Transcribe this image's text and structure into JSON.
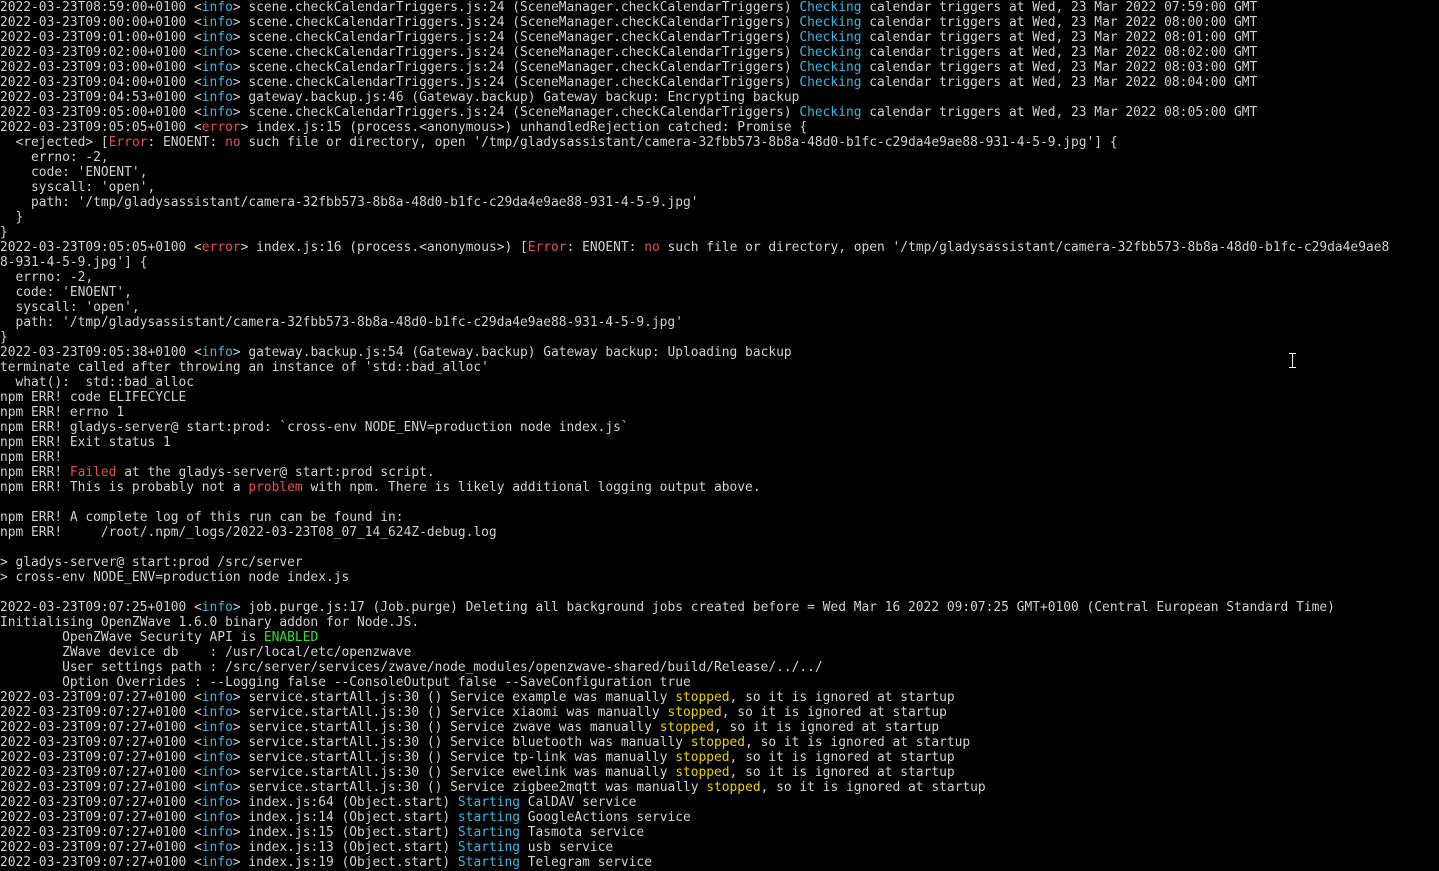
{
  "colors": {
    "background": "#000000",
    "default_text": "#d0d0d0",
    "cyan": "#3cb6e0",
    "red": "#e0505a",
    "yellow": "#e8d000",
    "green": "#3ad83a"
  },
  "cursor": {
    "icon": "text-cursor-ibeam"
  },
  "lines": [
    [
      [
        "p",
        "2022-03-23T08:59:00+0100 <"
      ],
      [
        "c",
        "info"
      ],
      [
        "p",
        "> scene.checkCalendarTriggers.js:24 (SceneManager.checkCalendarTriggers) "
      ],
      [
        "c",
        "Checking"
      ],
      [
        "p",
        " calendar triggers at Wed, 23 Mar 2022 07:59:00 GMT"
      ]
    ],
    [
      [
        "p",
        "2022-03-23T09:00:00+0100 <"
      ],
      [
        "c",
        "info"
      ],
      [
        "p",
        "> scene.checkCalendarTriggers.js:24 (SceneManager.checkCalendarTriggers) "
      ],
      [
        "c",
        "Checking"
      ],
      [
        "p",
        " calendar triggers at Wed, 23 Mar 2022 08:00:00 GMT"
      ]
    ],
    [
      [
        "p",
        "2022-03-23T09:01:00+0100 <"
      ],
      [
        "c",
        "info"
      ],
      [
        "p",
        "> scene.checkCalendarTriggers.js:24 (SceneManager.checkCalendarTriggers) "
      ],
      [
        "c",
        "Checking"
      ],
      [
        "p",
        " calendar triggers at Wed, 23 Mar 2022 08:01:00 GMT"
      ]
    ],
    [
      [
        "p",
        "2022-03-23T09:02:00+0100 <"
      ],
      [
        "c",
        "info"
      ],
      [
        "p",
        "> scene.checkCalendarTriggers.js:24 (SceneManager.checkCalendarTriggers) "
      ],
      [
        "c",
        "Checking"
      ],
      [
        "p",
        " calendar triggers at Wed, 23 Mar 2022 08:02:00 GMT"
      ]
    ],
    [
      [
        "p",
        "2022-03-23T09:03:00+0100 <"
      ],
      [
        "c",
        "info"
      ],
      [
        "p",
        "> scene.checkCalendarTriggers.js:24 (SceneManager.checkCalendarTriggers) "
      ],
      [
        "c",
        "Checking"
      ],
      [
        "p",
        " calendar triggers at Wed, 23 Mar 2022 08:03:00 GMT"
      ]
    ],
    [
      [
        "p",
        "2022-03-23T09:04:00+0100 <"
      ],
      [
        "c",
        "info"
      ],
      [
        "p",
        "> scene.checkCalendarTriggers.js:24 (SceneManager.checkCalendarTriggers) "
      ],
      [
        "c",
        "Checking"
      ],
      [
        "p",
        " calendar triggers at Wed, 23 Mar 2022 08:04:00 GMT"
      ]
    ],
    [
      [
        "p",
        "2022-03-23T09:04:53+0100 <"
      ],
      [
        "c",
        "info"
      ],
      [
        "p",
        "> gateway.backup.js:46 (Gateway.backup) Gateway backup: Encrypting backup"
      ]
    ],
    [
      [
        "p",
        "2022-03-23T09:05:00+0100 <"
      ],
      [
        "c",
        "info"
      ],
      [
        "p",
        "> scene.checkCalendarTriggers.js:24 (SceneManager.checkCalendarTriggers) "
      ],
      [
        "c",
        "Checking"
      ],
      [
        "p",
        " calendar triggers at Wed, 23 Mar 2022 08:05:00 GMT"
      ]
    ],
    [
      [
        "p",
        "2022-03-23T09:05:05+0100 <"
      ],
      [
        "r",
        "error"
      ],
      [
        "p",
        "> index.js:15 (process.<anonymous>) unhandledRejection catched: Promise {"
      ]
    ],
    [
      [
        "p",
        "  <rejected> ["
      ],
      [
        "r",
        "Error"
      ],
      [
        "p",
        ": ENOENT: "
      ],
      [
        "r",
        "no"
      ],
      [
        "p",
        " such file or directory, open '/tmp/gladysassistant/camera-32fbb573-8b8a-48d0-b1fc-c29da4e9ae88-931-4-5-9.jpg'] {"
      ]
    ],
    [
      [
        "p",
        "    errno: -2,"
      ]
    ],
    [
      [
        "p",
        "    code: 'ENOENT',"
      ]
    ],
    [
      [
        "p",
        "    syscall: 'open',"
      ]
    ],
    [
      [
        "p",
        "    path: '/tmp/gladysassistant/camera-32fbb573-8b8a-48d0-b1fc-c29da4e9ae88-931-4-5-9.jpg'"
      ]
    ],
    [
      [
        "p",
        "  }"
      ]
    ],
    [
      [
        "p",
        "}"
      ]
    ],
    [
      [
        "p",
        "2022-03-23T09:05:05+0100 <"
      ],
      [
        "r",
        "error"
      ],
      [
        "p",
        "> index.js:16 (process.<anonymous>) ["
      ],
      [
        "r",
        "Error"
      ],
      [
        "p",
        ": ENOENT: "
      ],
      [
        "r",
        "no"
      ],
      [
        "p",
        " such file or directory, open '/tmp/gladysassistant/camera-32fbb573-8b8a-48d0-b1fc-c29da4e9ae8"
      ]
    ],
    [
      [
        "p",
        "8-931-4-5-9.jpg'] {"
      ]
    ],
    [
      [
        "p",
        "  errno: -2,"
      ]
    ],
    [
      [
        "p",
        "  code: 'ENOENT',"
      ]
    ],
    [
      [
        "p",
        "  syscall: 'open',"
      ]
    ],
    [
      [
        "p",
        "  path: '/tmp/gladysassistant/camera-32fbb573-8b8a-48d0-b1fc-c29da4e9ae88-931-4-5-9.jpg'"
      ]
    ],
    [
      [
        "p",
        "}"
      ]
    ],
    [
      [
        "p",
        "2022-03-23T09:05:38+0100 <"
      ],
      [
        "c",
        "info"
      ],
      [
        "p",
        "> gateway.backup.js:54 (Gateway.backup) Gateway backup: Uploading backup"
      ]
    ],
    [
      [
        "p",
        "terminate called after throwing an instance of 'std::bad_alloc'"
      ]
    ],
    [
      [
        "p",
        "  what():  std::bad_alloc"
      ]
    ],
    [
      [
        "p",
        "npm ERR! code ELIFECYCLE"
      ]
    ],
    [
      [
        "p",
        "npm ERR! errno 1"
      ]
    ],
    [
      [
        "p",
        "npm ERR! gladys-server@ start:prod: `cross-env NODE_ENV=production node index.js`"
      ]
    ],
    [
      [
        "p",
        "npm ERR! Exit status 1"
      ]
    ],
    [
      [
        "p",
        "npm ERR!"
      ]
    ],
    [
      [
        "p",
        "npm ERR! "
      ],
      [
        "r",
        "Failed"
      ],
      [
        "p",
        " at the gladys-server@ start:prod script."
      ]
    ],
    [
      [
        "p",
        "npm ERR! This is probably not a "
      ],
      [
        "r",
        "problem"
      ],
      [
        "p",
        " with npm. There is likely additional logging output above."
      ]
    ],
    [
      [
        "p",
        ""
      ]
    ],
    [
      [
        "p",
        "npm ERR! A complete log of this run can be found in:"
      ]
    ],
    [
      [
        "p",
        "npm ERR!     /root/.npm/_logs/2022-03-23T08_07_14_624Z-debug.log"
      ]
    ],
    [
      [
        "p",
        ""
      ]
    ],
    [
      [
        "p",
        "> gladys-server@ start:prod /src/server"
      ]
    ],
    [
      [
        "p",
        "> cross-env NODE_ENV=production node index.js"
      ]
    ],
    [
      [
        "p",
        ""
      ]
    ],
    [
      [
        "p",
        "2022-03-23T09:07:25+0100 <"
      ],
      [
        "c",
        "info"
      ],
      [
        "p",
        "> job.purge.js:17 (Job.purge) Deleting all background jobs created before = Wed Mar 16 2022 09:07:25 GMT+0100 (Central European Standard Time)"
      ]
    ],
    [
      [
        "p",
        "Initialising OpenZWave 1.6.0 binary addon for Node.JS."
      ]
    ],
    [
      [
        "p",
        "        OpenZWave Security API is "
      ],
      [
        "g",
        "ENABLED"
      ]
    ],
    [
      [
        "p",
        "        ZWave device db    : /usr/local/etc/openzwave"
      ]
    ],
    [
      [
        "p",
        "        User settings path : /src/server/services/zwave/node_modules/openzwave-shared/build/Release/../../"
      ]
    ],
    [
      [
        "p",
        "        Option Overrides : --Logging false --ConsoleOutput false --SaveConfiguration true"
      ]
    ],
    [
      [
        "p",
        "2022-03-23T09:07:27+0100 <"
      ],
      [
        "c",
        "info"
      ],
      [
        "p",
        "> service.startAll.js:30 () Service example was manually "
      ],
      [
        "y",
        "stopped"
      ],
      [
        "p",
        ", so it is ignored at startup"
      ]
    ],
    [
      [
        "p",
        "2022-03-23T09:07:27+0100 <"
      ],
      [
        "c",
        "info"
      ],
      [
        "p",
        "> service.startAll.js:30 () Service xiaomi was manually "
      ],
      [
        "y",
        "stopped"
      ],
      [
        "p",
        ", so it is ignored at startup"
      ]
    ],
    [
      [
        "p",
        "2022-03-23T09:07:27+0100 <"
      ],
      [
        "c",
        "info"
      ],
      [
        "p",
        "> service.startAll.js:30 () Service zwave was manually "
      ],
      [
        "y",
        "stopped"
      ],
      [
        "p",
        ", so it is ignored at startup"
      ]
    ],
    [
      [
        "p",
        "2022-03-23T09:07:27+0100 <"
      ],
      [
        "c",
        "info"
      ],
      [
        "p",
        "> service.startAll.js:30 () Service bluetooth was manually "
      ],
      [
        "y",
        "stopped"
      ],
      [
        "p",
        ", so it is ignored at startup"
      ]
    ],
    [
      [
        "p",
        "2022-03-23T09:07:27+0100 <"
      ],
      [
        "c",
        "info"
      ],
      [
        "p",
        "> service.startAll.js:30 () Service tp-link was manually "
      ],
      [
        "y",
        "stopped"
      ],
      [
        "p",
        ", so it is ignored at startup"
      ]
    ],
    [
      [
        "p",
        "2022-03-23T09:07:27+0100 <"
      ],
      [
        "c",
        "info"
      ],
      [
        "p",
        "> service.startAll.js:30 () Service ewelink was manually "
      ],
      [
        "y",
        "stopped"
      ],
      [
        "p",
        ", so it is ignored at startup"
      ]
    ],
    [
      [
        "p",
        "2022-03-23T09:07:27+0100 <"
      ],
      [
        "c",
        "info"
      ],
      [
        "p",
        "> service.startAll.js:30 () Service zigbee2mqtt was manually "
      ],
      [
        "y",
        "stopped"
      ],
      [
        "p",
        ", so it is ignored at startup"
      ]
    ],
    [
      [
        "p",
        "2022-03-23T09:07:27+0100 <"
      ],
      [
        "c",
        "info"
      ],
      [
        "p",
        "> index.js:64 (Object.start) "
      ],
      [
        "c",
        "Starting"
      ],
      [
        "p",
        " CalDAV service"
      ]
    ],
    [
      [
        "p",
        "2022-03-23T09:07:27+0100 <"
      ],
      [
        "c",
        "info"
      ],
      [
        "p",
        "> index.js:14 (Object.start) "
      ],
      [
        "c",
        "starting"
      ],
      [
        "p",
        " GoogleActions service"
      ]
    ],
    [
      [
        "p",
        "2022-03-23T09:07:27+0100 <"
      ],
      [
        "c",
        "info"
      ],
      [
        "p",
        "> index.js:15 (Object.start) "
      ],
      [
        "c",
        "Starting"
      ],
      [
        "p",
        " Tasmota service"
      ]
    ],
    [
      [
        "p",
        "2022-03-23T09:07:27+0100 <"
      ],
      [
        "c",
        "info"
      ],
      [
        "p",
        "> index.js:13 (Object.start) "
      ],
      [
        "c",
        "Starting"
      ],
      [
        "p",
        " usb service"
      ]
    ],
    [
      [
        "p",
        "2022-03-23T09:07:27+0100 <"
      ],
      [
        "c",
        "info"
      ],
      [
        "p",
        "> index.js:19 (Object.start) "
      ],
      [
        "c",
        "Starting"
      ],
      [
        "p",
        " Telegram service"
      ]
    ]
  ]
}
